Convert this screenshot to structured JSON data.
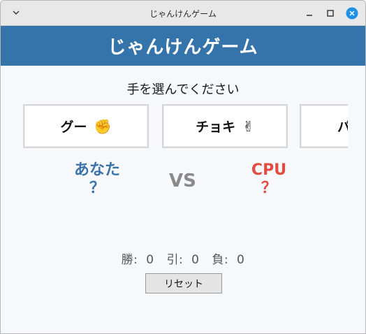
{
  "window": {
    "title": "じゃんけんゲーム"
  },
  "header": {
    "title": "じゃんけんゲーム"
  },
  "prompt": "手を選んでください",
  "choices": [
    {
      "label": "グー",
      "emoji": "✊"
    },
    {
      "label": "チョキ",
      "emoji": "✌"
    },
    {
      "label": "パ"
    }
  ],
  "players": {
    "you": {
      "name": "あなた",
      "hand": "？"
    },
    "vs": "VS",
    "cpu": {
      "name": "CPU",
      "hand": "？"
    }
  },
  "score": {
    "wins_label": "勝:",
    "wins": "0",
    "draws_label": "引:",
    "draws": "0",
    "losses_label": "負:",
    "losses": "0"
  },
  "reset_label": "リセット",
  "colors": {
    "header_bg": "#3574ab",
    "you": "#3a73aa",
    "cpu": "#e04c3f",
    "close_button": "#1e90e6"
  }
}
